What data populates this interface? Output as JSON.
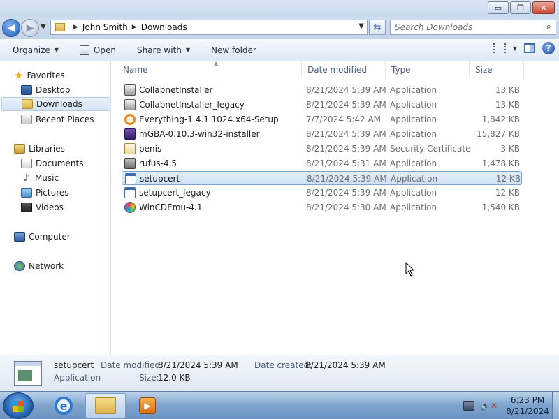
{
  "window": {
    "controls": {
      "minimize": "▭",
      "maximize": "❐",
      "close": "✕"
    }
  },
  "address": {
    "crumbs": [
      "John Smith",
      "Downloads"
    ],
    "search_placeholder": "Search Downloads"
  },
  "toolbar": {
    "organize": "Organize",
    "open": "Open",
    "share_with": "Share with",
    "new_folder": "New folder"
  },
  "nav": {
    "favorites": "Favorites",
    "desktop": "Desktop",
    "downloads": "Downloads",
    "recent_places": "Recent Places",
    "libraries": "Libraries",
    "documents": "Documents",
    "music": "Music",
    "pictures": "Pictures",
    "videos": "Videos",
    "computer": "Computer",
    "network": "Network"
  },
  "columns": {
    "name": "Name",
    "date": "Date modified",
    "type": "Type",
    "size": "Size"
  },
  "files": [
    {
      "name": "CollabnetInstaller",
      "date": "8/21/2024 5:39 AM",
      "type": "Application",
      "size": "13 KB",
      "icon": "app-icon"
    },
    {
      "name": "CollabnetInstaller_legacy",
      "date": "8/21/2024 5:39 AM",
      "type": "Application",
      "size": "13 KB",
      "icon": "app-icon"
    },
    {
      "name": "Everything-1.4.1.1024.x64-Setup",
      "date": "7/7/2024 5:42 AM",
      "type": "Application",
      "size": "1,842 KB",
      "icon": "search-app-icon"
    },
    {
      "name": "mGBA-0.10.3-win32-installer",
      "date": "8/21/2024 5:39 AM",
      "type": "Application",
      "size": "15,827 KB",
      "icon": "gba-icon"
    },
    {
      "name": "penis",
      "date": "8/21/2024 5:39 AM",
      "type": "Security Certificate",
      "size": "3 KB",
      "icon": "certificate-icon"
    },
    {
      "name": "rufus-4.5",
      "date": "8/21/2024 5:31 AM",
      "type": "Application",
      "size": "1,478 KB",
      "icon": "usb-icon"
    },
    {
      "name": "setupcert",
      "date": "8/21/2024 5:39 AM",
      "type": "Application",
      "size": "12 KB",
      "icon": "window-app-icon",
      "selected": true
    },
    {
      "name": "setupcert_legacy",
      "date": "8/21/2024 5:39 AM",
      "type": "Application",
      "size": "12 KB",
      "icon": "window-app-icon"
    },
    {
      "name": "WinCDEmu-4.1",
      "date": "8/21/2024 5:30 AM",
      "type": "Application",
      "size": "1,540 KB",
      "icon": "cd-icon"
    }
  ],
  "details": {
    "name": "setupcert",
    "type": "Application",
    "date_modified_label": "Date modified:",
    "date_modified": "8/21/2024 5:39 AM",
    "date_created_label": "Date created:",
    "date_created": "8/21/2024 5:39 AM",
    "size_label": "Size:",
    "size": "12.0 KB"
  },
  "taskbar": {
    "time": "6:23 PM",
    "date": "8/21/2024"
  }
}
